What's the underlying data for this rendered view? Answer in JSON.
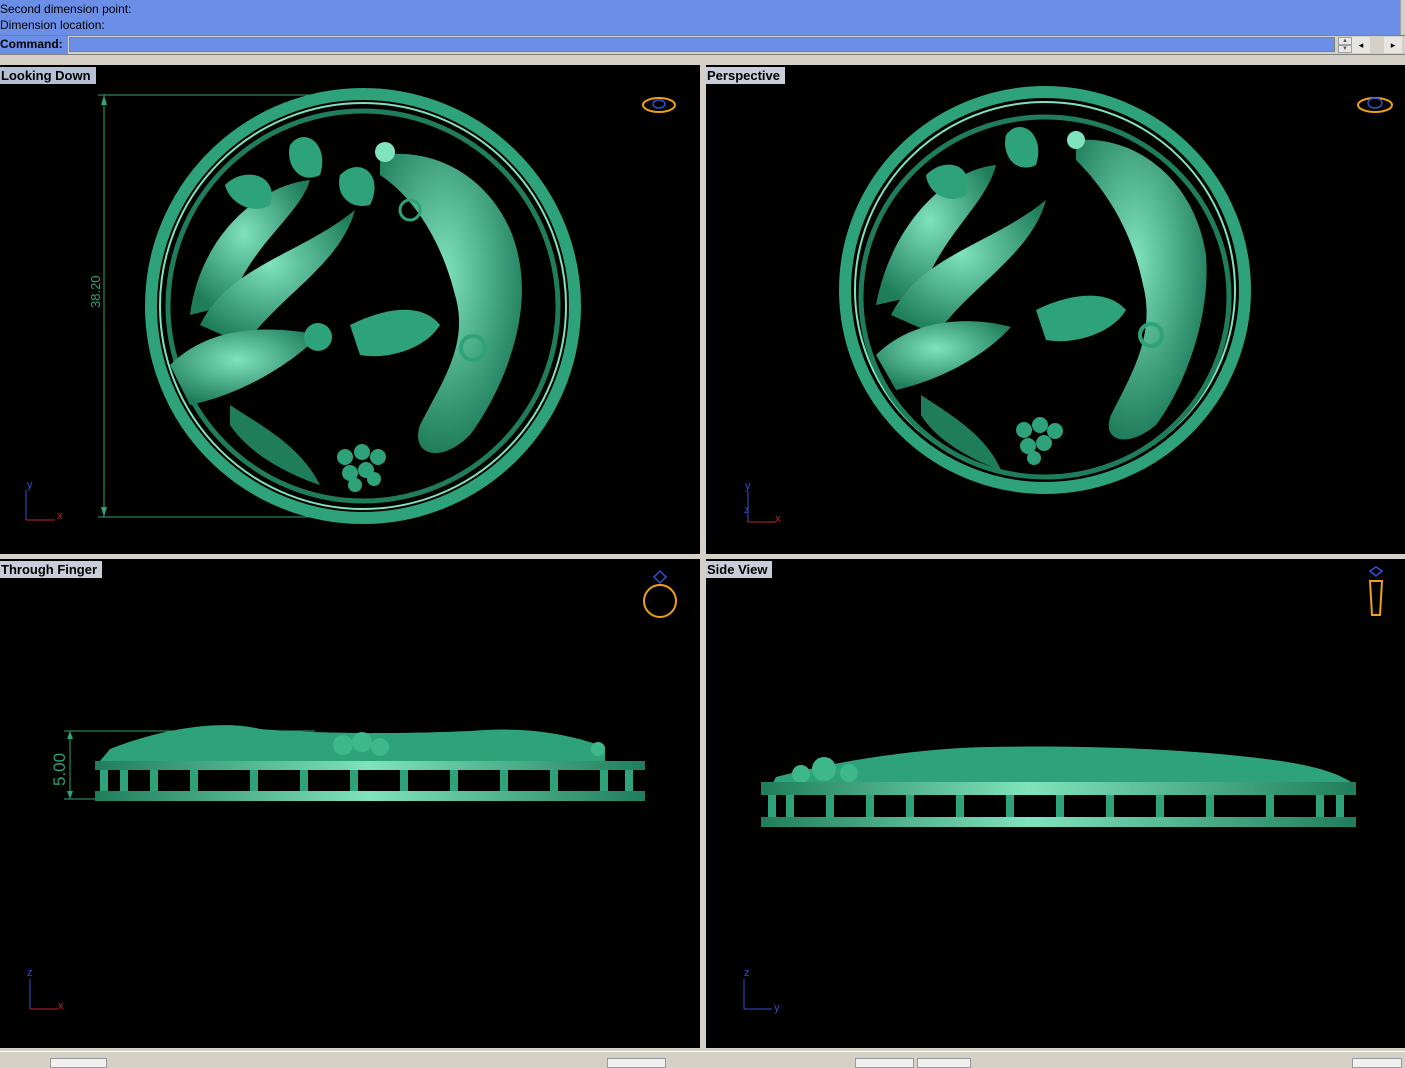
{
  "history": {
    "lines": [
      "Second dimension point:",
      "Dimension location:"
    ]
  },
  "command": {
    "label": "Command:",
    "value": "",
    "scroll_left": "◂",
    "scroll_right": "▸"
  },
  "viewports": {
    "top_left": {
      "label": "Looking Down",
      "dimension": "38.20",
      "axis_v": "y",
      "axis_h": "x",
      "nav_icon": "ring-top-view-icon"
    },
    "top_right": {
      "label": "Perspective",
      "axis_v": "y",
      "axis_z": "z",
      "axis_h": "x",
      "nav_icon": "ring-perspective-icon"
    },
    "bottom_left": {
      "label": "Through Finger",
      "dimension": "5.00",
      "axis_v": "z",
      "axis_h": "x",
      "nav_icon": "ring-front-view-icon"
    },
    "bottom_right": {
      "label": "Side View",
      "axis_v": "z",
      "axis_h": "y",
      "nav_icon": "ring-side-view-icon"
    }
  },
  "colors": {
    "model_green": "#2ea27a",
    "model_highlight": "#7fe3bd",
    "history_bg": "#6b8fe6",
    "viewport_bg": "#000000",
    "axis_red": "#c0262c",
    "axis_blue": "#3050d0",
    "icon_orange": "#f0a018"
  }
}
